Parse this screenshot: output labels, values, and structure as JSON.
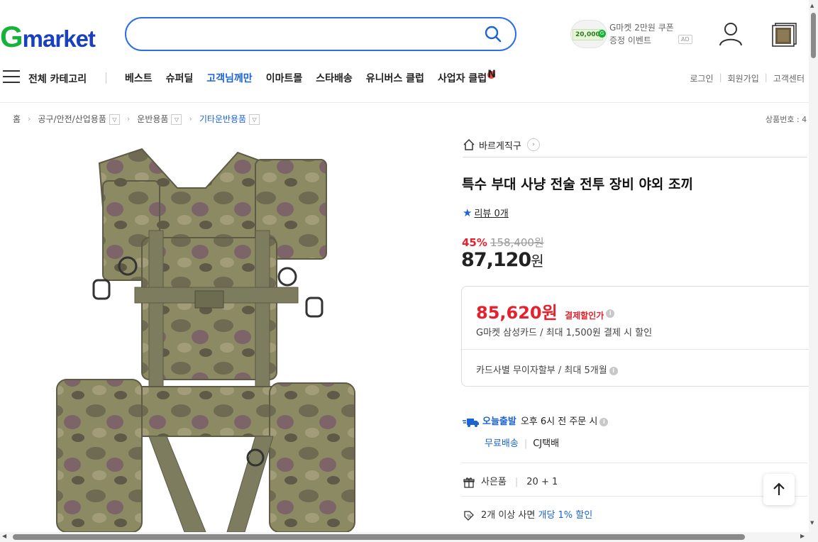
{
  "header": {
    "logo_g": "G",
    "logo_rest": "market",
    "search_placeholder": "",
    "promo": {
      "amount": "20,000",
      "g_badge": "G",
      "line1": "G마켓 2만원 쿠폰",
      "line2": "증정 이벤트",
      "ad_label": "AD"
    }
  },
  "nav": {
    "all_categories": "전체 카테고리",
    "menu": [
      {
        "label": "베스트"
      },
      {
        "label": "슈퍼딜"
      },
      {
        "label": "고객님께만"
      },
      {
        "label": "이마트몰"
      },
      {
        "label": "스타배송"
      },
      {
        "label": "유니버스 클럽"
      },
      {
        "label": "사업자 클럽"
      }
    ],
    "new_badge": "N",
    "util": {
      "login": "로그인",
      "join": "회원가입",
      "support": "고객센터"
    }
  },
  "breadcrumb": {
    "home": "홈",
    "level1": "공구/안전/산업용품",
    "level2": "운반용품",
    "level3": "기타운반용품",
    "product_no_label": "상품번호 : 4"
  },
  "product": {
    "store_name": "바르게직구",
    "title": "특수 부대 사냥 전술 전투 장비 야외 조끼",
    "review_label": "리뷰 0개",
    "discount_rate": "45%",
    "original_price": "158,400원",
    "price_number": "87,120",
    "price_unit": "원",
    "card": {
      "discount_price": "85,620원",
      "discount_label": "결제할인가",
      "card_desc": "G마켓 삼성카드 / 최대 1,500원 결제 시 할인",
      "installment": "카드사별 무이자할부 / 최대 5개월"
    },
    "shipping": {
      "today_label": "오늘출발",
      "cutoff": "오후 6시 전 주문 시",
      "free_label": "무료배송",
      "courier": "CJ택배"
    },
    "gift": {
      "label": "사은품",
      "value": "20 + 1"
    },
    "multi": {
      "text": "2개 이상 사면",
      "highlight": "개당 1% 할인"
    }
  },
  "colors": {
    "brand_blue": "#1c64d6",
    "brand_green": "#16b23a",
    "sale_red": "#e5212d"
  },
  "icons": {
    "search": "search-icon",
    "user": "user-icon",
    "top": "arrow-up-icon",
    "info": "info-icon"
  }
}
